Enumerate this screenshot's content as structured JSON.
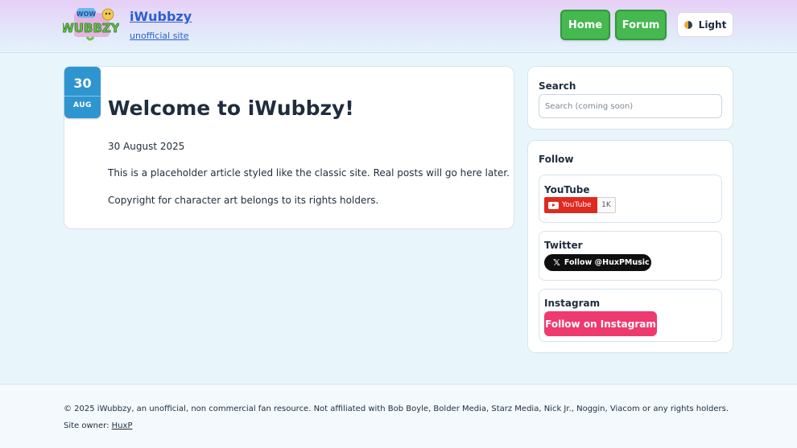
{
  "header": {
    "site_title": "iWubbzy",
    "site_subtitle": "unofficial site",
    "logo_icon": "wubbzy-logo-icon",
    "nav": [
      {
        "label": "Home"
      },
      {
        "label": "Forum"
      }
    ],
    "theme_toggle_label": "Light",
    "theme_icon": "half-moon-icon"
  },
  "article": {
    "date_day": "30",
    "date_month": "AUG",
    "title": "Welcome to iWubbzy!",
    "date_text": "30 August 2025",
    "paragraphs": [
      "This is a placeholder article styled like the classic site. Real posts will go here later.",
      "Copyright for character art belongs to its rights holders."
    ]
  },
  "sidebar": {
    "search": {
      "heading": "Search",
      "placeholder": "Search (coming soon)"
    },
    "follow": {
      "heading": "Follow",
      "youtube": {
        "title": "YouTube",
        "button_label": "YouTube",
        "count": "1K"
      },
      "twitter": {
        "title": "Twitter",
        "button_label": "Follow @HuxPMusic"
      },
      "instagram": {
        "title": "Instagram",
        "button_label": "Follow on Instagram"
      }
    }
  },
  "footer": {
    "copyright": "© 2025 iWubbzy, an unofficial, non commercial fan resource. Not affiliated with Bob Boyle, Bolder Media, Starz Media, Nick Jr., Noggin, Viacom or any rights holders.",
    "owner_label": "Site owner:",
    "owner_link": "HuxP"
  },
  "colors": {
    "accent_blue": "#2f95d0",
    "nav_green": "#45b84f",
    "youtube_red": "#e02a20",
    "instagram_pink": "#ed3a6f",
    "link_blue": "#2a5fd0"
  }
}
